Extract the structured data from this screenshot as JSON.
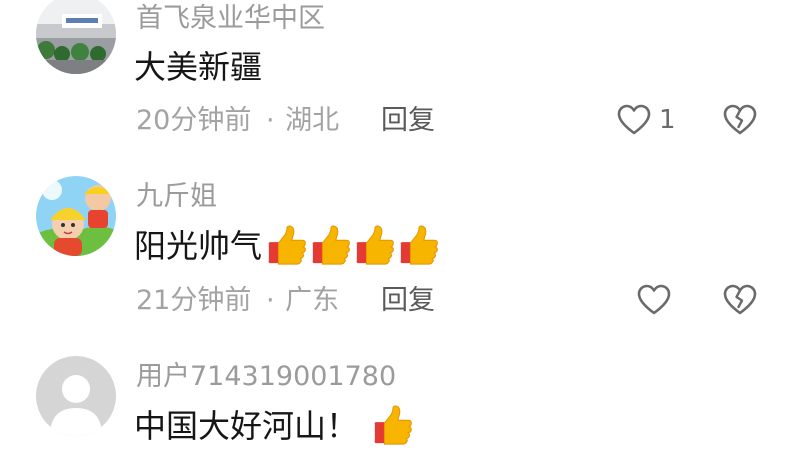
{
  "comments": [
    {
      "username": "首飞泉业华中区",
      "text": "大美新疆",
      "time": "20分钟前",
      "separator": "·",
      "location": "湖北",
      "reply_label": "回复",
      "like_count": "1",
      "avatar_icon": "office-building-photo-avatar",
      "thumbs": 0
    },
    {
      "username": "九斤姐",
      "text": "阳光帅气",
      "time": "21分钟前",
      "separator": "·",
      "location": "广东",
      "reply_label": "回复",
      "like_count": "",
      "avatar_icon": "cartoon-child-avatar",
      "thumbs": 4
    },
    {
      "username": "用户714319001780",
      "text": "中国大好河山！",
      "avatar_icon": "default-user-avatar",
      "thumbs": 1
    }
  ],
  "icons": {
    "like": "heart-outline-icon",
    "dislike": "broken-heart-icon",
    "emoji": "thumbs-up-emoji"
  },
  "colors": {
    "username": "#9b9b9b",
    "text": "#161616",
    "meta": "#a3a3a3",
    "reply": "#5a5a5a",
    "icon": "#6a6a6a",
    "thumb": "#f7b500"
  }
}
